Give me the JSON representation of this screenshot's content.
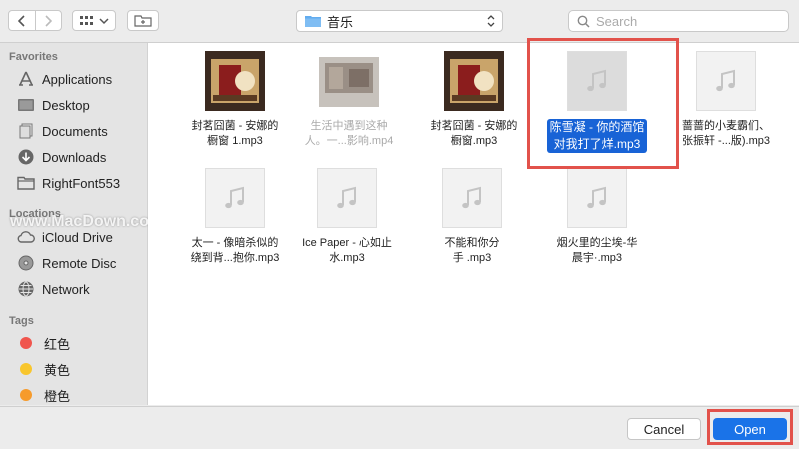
{
  "toolbar": {
    "location": "音乐",
    "search_placeholder": "Search"
  },
  "sidebar": {
    "favorites_header": "Favorites",
    "favorites": [
      {
        "label": "Applications",
        "icon": "applications-icon"
      },
      {
        "label": "Desktop",
        "icon": "desktop-icon"
      },
      {
        "label": "Documents",
        "icon": "documents-icon"
      },
      {
        "label": "Downloads",
        "icon": "downloads-icon"
      },
      {
        "label": "RightFont553",
        "icon": "folder-icon"
      }
    ],
    "locations_header": "Locations",
    "locations": [
      {
        "label": "iCloud Drive",
        "icon": "cloud-icon"
      },
      {
        "label": "Remote Disc",
        "icon": "disc-icon"
      },
      {
        "label": "Network",
        "icon": "network-icon"
      }
    ],
    "tags_header": "Tags",
    "tags": [
      {
        "label": "红色",
        "color": "#f0554d"
      },
      {
        "label": "黄色",
        "color": "#f8c62d"
      },
      {
        "label": "橙色",
        "color": "#f69b2c"
      }
    ]
  },
  "files": [
    {
      "line1": "封茗囧菌 - 安娜的",
      "line2": "橱窗 1.mp3",
      "thumb": "album-art"
    },
    {
      "line1": "生活中遇到这种",
      "line2": "人。一...影响.mp4",
      "thumb": "video",
      "dimmed": true
    },
    {
      "line1": "封茗囧菌 - 安娜的",
      "line2": "橱窗.mp3",
      "thumb": "album-art"
    },
    {
      "line1": "陈雪凝 - 你的酒馆",
      "line2": "对我打了烊.mp3",
      "thumb": "music",
      "selected": true
    },
    {
      "line1": "蔷蔷的小麦霸们、",
      "line2": "张振轩 -...版).mp3",
      "thumb": "music"
    },
    {
      "line1": "太一 - 像暗杀似的",
      "line2": "绕到背...抱你.mp3",
      "thumb": "music"
    },
    {
      "line1": "Ice Paper - 心如止",
      "line2": "水.mp3",
      "thumb": "music"
    },
    {
      "line1": "不能和你分",
      "line2": "手 .mp3",
      "thumb": "music"
    },
    {
      "line1": "烟火里的尘埃-华",
      "line2": "晨宇·.mp3",
      "thumb": "music"
    }
  ],
  "footer": {
    "cancel_label": "Cancel",
    "open_label": "Open"
  },
  "watermark": "www.MacDown.com",
  "colors": {
    "selection": "#1863d6",
    "highlight": "#e2524b",
    "open_button": "#1a73e8"
  }
}
